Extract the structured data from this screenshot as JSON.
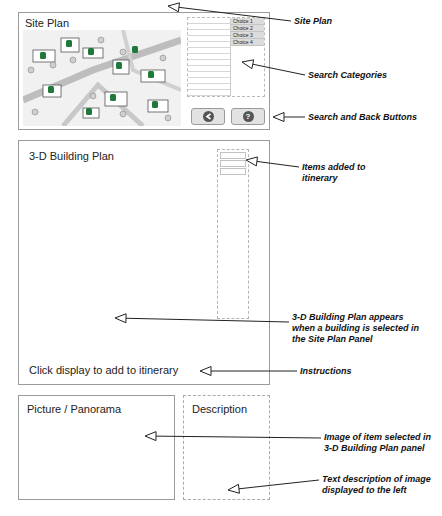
{
  "site_plan": {
    "title": "Site Plan",
    "choices": [
      "Choice 1",
      "Choice 2",
      "Choice 3",
      "Choice 4"
    ],
    "help_label": "?"
  },
  "building_plan": {
    "title": "3-D Building Plan",
    "instructions": "Click display to add to itinerary"
  },
  "picture": {
    "title": "Picture / Panorama"
  },
  "description": {
    "title": "Description"
  },
  "annotations": [
    {
      "text": "Site Plan"
    },
    {
      "text": "Search Categories"
    },
    {
      "text": "Search and Back Buttons"
    },
    {
      "text": "Items added to itinerary"
    },
    {
      "text": "3-D Building Plan appears when a building is selected in the Site Plan Panel"
    },
    {
      "text": "Instructions"
    },
    {
      "text": "Image of item selected in 3-D Building Plan panel"
    },
    {
      "text": "Text description of image displayed to the left"
    }
  ]
}
